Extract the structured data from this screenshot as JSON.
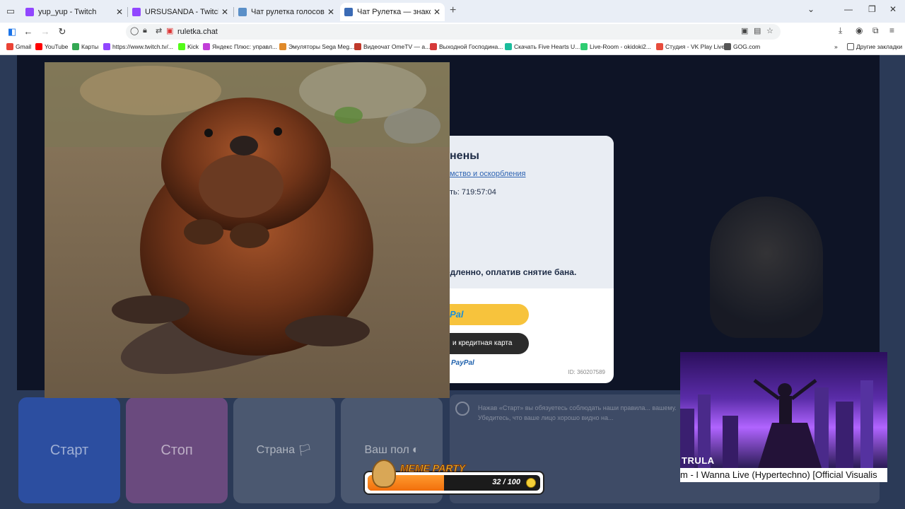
{
  "tabs": [
    {
      "title": "yup_yup - Twitch",
      "favicon_color": "#9146ff",
      "active": false
    },
    {
      "title": "URSUSANDA - Twitch",
      "favicon_color": "#9146ff",
      "active": false
    },
    {
      "title": "Чат рулетка голосовая — Nek",
      "favicon_color": "#5a8fc8",
      "active": false
    },
    {
      "title": "Чат Рулетка — знакомства и с",
      "favicon_color": "#3b6bb5",
      "active": true
    }
  ],
  "address": {
    "url": "ruletka.chat"
  },
  "bookmarks": [
    {
      "label": "Gmail",
      "color": "#ea4335"
    },
    {
      "label": "YouTube",
      "color": "#ff0000"
    },
    {
      "label": "Карты",
      "color": "#34a853"
    },
    {
      "label": "https://www.twitch.tv/...",
      "color": "#9146ff"
    },
    {
      "label": "Kick",
      "color": "#53fc18"
    },
    {
      "label": "Яндекс Плюс: управл...",
      "color": "#c23fd8"
    },
    {
      "label": "Эмуляторы Sega Meg...",
      "color": "#e08a2a"
    },
    {
      "label": "Видеочат OmeTV — а...",
      "color": "#c0392b"
    },
    {
      "label": "Выходной Господина...",
      "color": "#d63a3a"
    },
    {
      "label": "Скачать Five Hearts U...",
      "color": "#1abc9c"
    },
    {
      "label": "Live-Room - okidoki2...",
      "color": "#2ecc71"
    },
    {
      "label": "Студия - VK Play Live",
      "color": "#e74c3c"
    },
    {
      "label": "GOG.com",
      "color": "#555555"
    }
  ],
  "other_bookmarks": "Другие закладки",
  "ban": {
    "title": "нены",
    "reason": "мство и оскорбления",
    "timer": "ть: 719:57:04",
    "offer": "едленно, оплатив снятие бана.",
    "paypal_label": "Pal",
    "card_label": "и кредитная карта",
    "powered": "PayPal",
    "id": "ID: 360207589"
  },
  "controls": {
    "start": "Старт",
    "stop": "Стоп",
    "country": "Страна",
    "gender": "Ваш пол"
  },
  "info_text": "Нажав «Старт» вы обязуетесь соблюдать наши правила... вашему. Убедитесь, что ваше лицо хорошо видно на...",
  "music": {
    "label": "TRULA",
    "track": "m - I Wanna Live (Hypertechno) [Official Visualis"
  },
  "meme": {
    "title": "MEME PARTY",
    "count": "32 / 100",
    "progress": 0.32
  }
}
